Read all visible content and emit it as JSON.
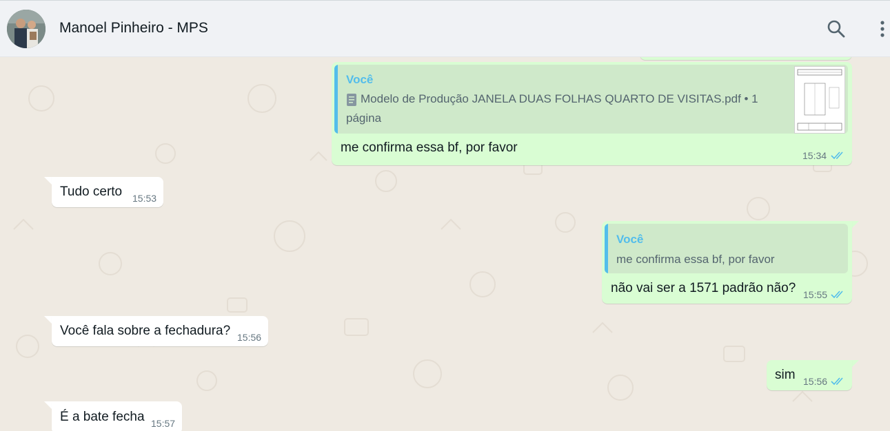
{
  "header": {
    "contact_name": "Manoel Pinheiro - MPS",
    "search_icon": "search-icon",
    "menu_icon": "more-vertical-icon"
  },
  "messages": [
    {
      "direction": "out",
      "quote_author": "Você",
      "quote_text_line1": "Modelo de Produção JANELA DUAS FOLHAS QUARTO DE VISITAS.pdf • 1",
      "quote_text_line2": "página",
      "quote_icon": "document-icon",
      "text": "me confirma essa bf, por favor",
      "time": "15:34",
      "status": "read"
    },
    {
      "direction": "in",
      "text": "Tudo certo",
      "time": "15:53"
    },
    {
      "direction": "out",
      "quote_author": "Você",
      "quote_text": "me confirma essa bf, por favor",
      "text": "não vai ser a 1571 padrão não?",
      "time": "15:55",
      "status": "read"
    },
    {
      "direction": "in",
      "text": "Você fala sobre a fechadura?",
      "time": "15:56"
    },
    {
      "direction": "out",
      "text": "sim",
      "time": "15:56",
      "status": "read"
    },
    {
      "direction": "in",
      "text": "É a bate fecha",
      "time": "15:57"
    }
  ],
  "colors": {
    "outgoing_bubble": "#d9fdd3",
    "incoming_bubble": "#ffffff",
    "chat_background": "#efeae2",
    "quote_accent": "#53bdeb",
    "read_ticks": "#53bdeb"
  }
}
